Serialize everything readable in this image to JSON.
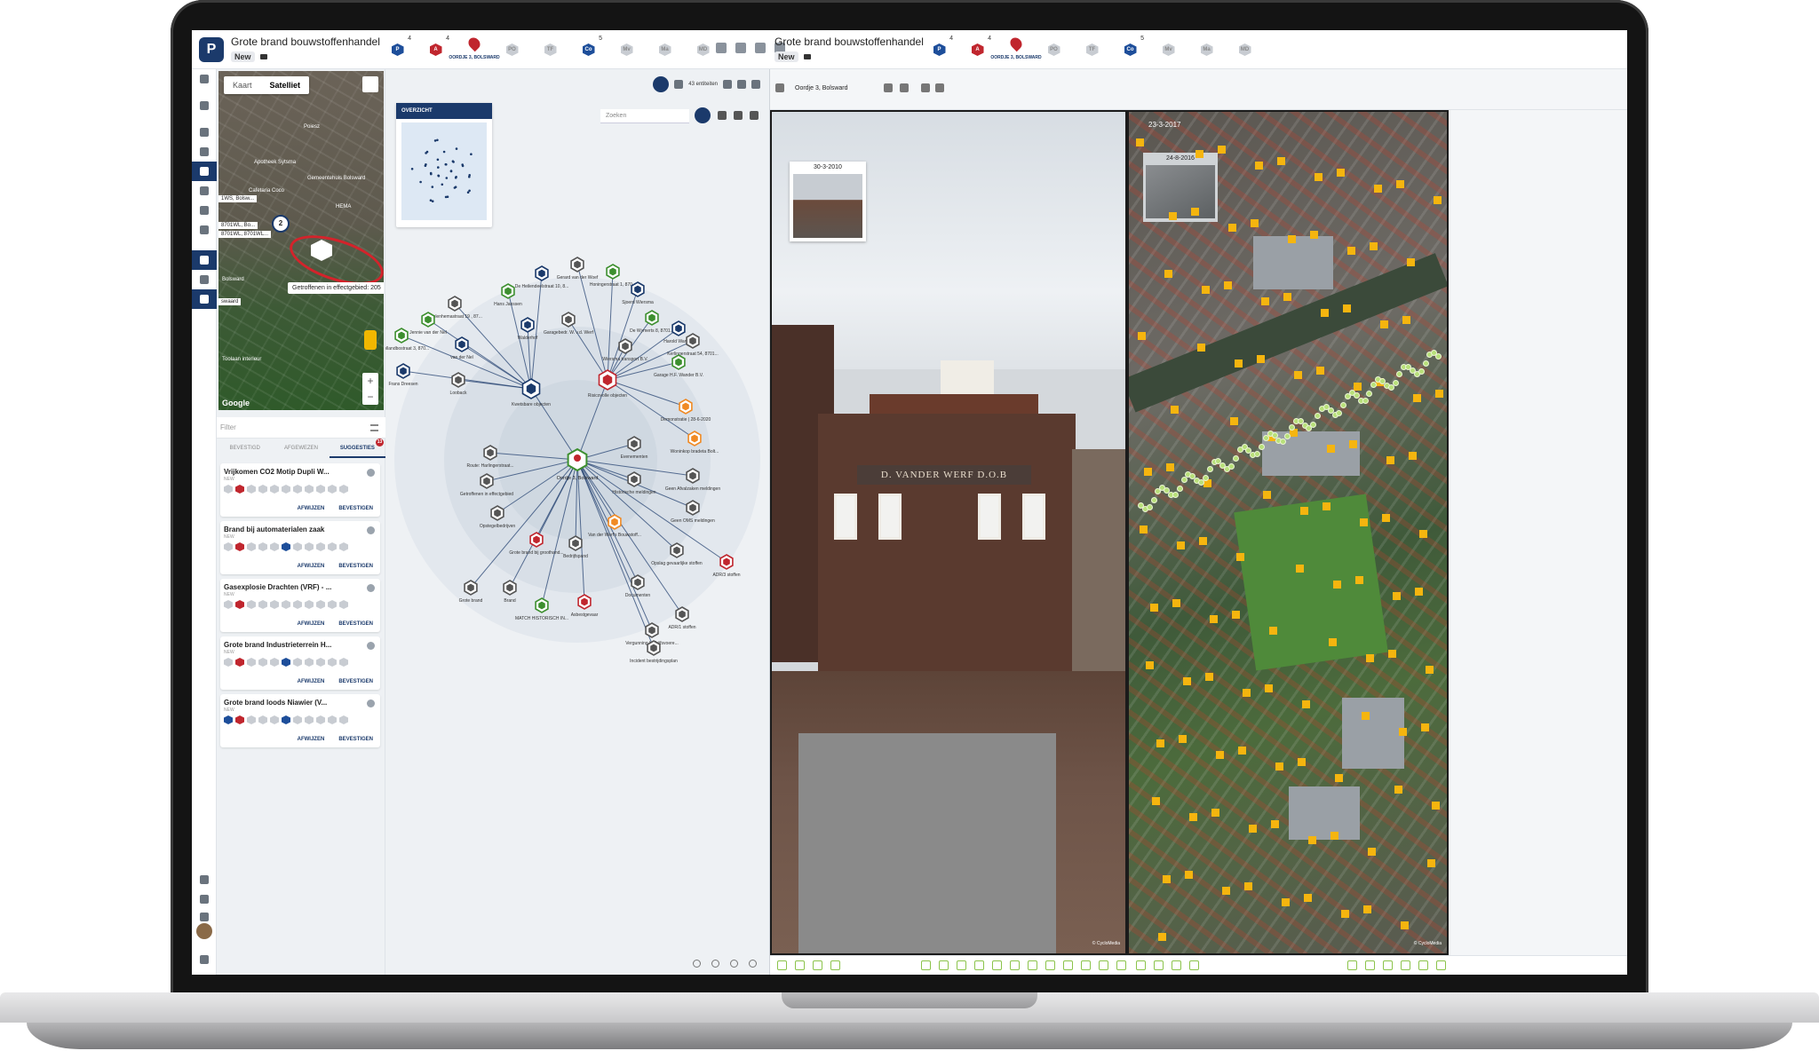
{
  "topbar": {
    "left_title": "Grote brand bouwstoffenhandel",
    "left_tag": "New",
    "right_title": "Grote brand bouwstoffenhandel",
    "right_tag": "New",
    "chips": [
      {
        "label": "P",
        "color": "blue",
        "count": "4"
      },
      {
        "label": "A",
        "color": "red",
        "count": "4"
      },
      {
        "label": "pin",
        "color": "red",
        "count": "",
        "caption": "OORDJE 3, BOLSWARD"
      },
      {
        "label": "PO",
        "color": "grey",
        "count": ""
      },
      {
        "label": "TF",
        "color": "grey",
        "count": ""
      },
      {
        "label": "Co",
        "color": "blue",
        "count": "5"
      },
      {
        "label": "Mv",
        "color": "grey",
        "count": ""
      },
      {
        "label": "Ma",
        "color": "grey",
        "count": ""
      },
      {
        "label": "MD",
        "color": "grey",
        "count": ""
      }
    ]
  },
  "map": {
    "tab_map": "Kaart",
    "tab_satellite": "Satelliet",
    "tooltip": "Getroffenen in effectgebied: 205",
    "cluster": "2",
    "labels": [
      "Poiesz",
      "Apotheek Sytsma",
      "Gemeentehuis Bolsward",
      "HEMA",
      "Cafetaria Coco",
      "Toolaan interieur",
      "Bolsward"
    ],
    "addr1": "1WS, Bolsw...",
    "addr2": "8701WL, Bo...",
    "addr3": "8701WL, 8701WL...",
    "addr4": "swaard",
    "google": "Google"
  },
  "suggestions": {
    "filter_placeholder": "Filter",
    "tabs": [
      "BEVESTIGD",
      "AFGEWEZEN",
      "SUGGESTIES"
    ],
    "badge": "13",
    "cards": [
      {
        "title": "Vrijkomen CO2 Motip Dupli W...",
        "status": "NEW",
        "reject": "AFWIJZEN",
        "confirm": "BEVESTIGEN"
      },
      {
        "title": "Brand bij automaterialen zaak",
        "status": "NEW",
        "reject": "AFWIJZEN",
        "confirm": "BEVESTIGEN"
      },
      {
        "title": "Gasexplosie Drachten (VRF) - ...",
        "status": "NEW",
        "reject": "AFWIJZEN",
        "confirm": "BEVESTIGEN"
      },
      {
        "title": "Grote brand Industrieterrein H...",
        "status": "NEW",
        "reject": "AFWIJZEN",
        "confirm": "BEVESTIGEN"
      },
      {
        "title": "Grote brand loods Niawier (V...",
        "status": "NEW",
        "reject": "AFWIJZEN",
        "confirm": "BEVESTIGEN"
      }
    ]
  },
  "graph": {
    "overview_title": "OVERZICHT",
    "entity_count": "43 entiteiten",
    "eye_count": "43",
    "search_placeholder": "Zoeken",
    "center_label": "Oordje 3, Bolsward",
    "nodes": [
      {
        "label": "Hans Janssen"
      },
      {
        "label": "De Heilendeelstraat 10, 8..."
      },
      {
        "label": "Gerard van der Woef"
      },
      {
        "label": "Honingerstraat 1, 870..."
      },
      {
        "label": "Sjoerd Wiersma"
      },
      {
        "label": "Roelenhemastraat 19 , 87..."
      },
      {
        "label": "Jennie van der Nel"
      },
      {
        "label": "Walderhof"
      },
      {
        "label": "Garagebedr. W. v.d. Werf"
      },
      {
        "label": "De Wymerts 8, 8701..."
      },
      {
        "label": "Harold Wander"
      },
      {
        "label": "Kerlingerstraat 54, 8701..."
      },
      {
        "label": "De Hollandbostraat 3, 870..."
      },
      {
        "label": "van der Nel"
      },
      {
        "label": "Wiersma transport B.V."
      },
      {
        "label": "Garage H.F. Wander B.V."
      },
      {
        "label": "Frans Dreesen"
      },
      {
        "label": "Looback"
      },
      {
        "label": "Kwetsbare objecten"
      },
      {
        "label": "Risicovolle objecten"
      },
      {
        "label": "Demonstratie | 28-6-2020"
      },
      {
        "label": "Woninkop bradeta Bolt..."
      },
      {
        "label": "Evenementen"
      },
      {
        "label": "Route: Harlingerstraat..."
      },
      {
        "label": "Getroffenen in effectgebied"
      },
      {
        "label": "Geen Afvalzaken meldingen"
      },
      {
        "label": "Historische meldingen"
      },
      {
        "label": "Geen OMS meldingen"
      },
      {
        "label": "Opstegelbedrijven"
      },
      {
        "label": "Van der Werf's Bouwstoff..."
      },
      {
        "label": "Grote brand bij groothand..."
      },
      {
        "label": "Bedrijfspand"
      },
      {
        "label": "Opslag gevaarlijke stoffen"
      },
      {
        "label": "ADR/3 stoffen"
      },
      {
        "label": "Grote brand"
      },
      {
        "label": "Brand"
      },
      {
        "label": "MATCH HISTORISCH IN..."
      },
      {
        "label": "Asbestgevaar"
      },
      {
        "label": "Documenten"
      },
      {
        "label": "ADR/1 stoffen"
      },
      {
        "label": "Vergunning bedrijfsvoere..."
      },
      {
        "label": "Incident bestrijdingsplan"
      }
    ]
  },
  "viewer": {
    "address": "Oordje 3, Bolsward",
    "street_date": "30-3-2010",
    "aerial_date": "23-3-2017",
    "aerial_thumb_date": "24-8-2016",
    "shop_sign": "D. VANDER WERF D.O.B",
    "copyright": "© CycloMedia"
  },
  "colors": {
    "brand": "#1b3a6b",
    "alert": "#c0262e",
    "accent_green": "#8bc34a",
    "marker_yellow": "#f5b50f"
  }
}
